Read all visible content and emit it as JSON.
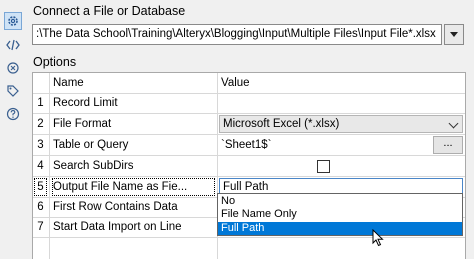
{
  "connect": {
    "label": "Connect a File or Database",
    "path_value": ":\\The Data School\\Training\\Alteryx\\Blogging\\Input\\Multiple Files\\Input File*.xlsx"
  },
  "options": {
    "label": "Options",
    "header": {
      "name": "Name",
      "value": "Value"
    },
    "rows": [
      {
        "num": "1",
        "name": "Record Limit",
        "value": ""
      },
      {
        "num": "2",
        "name": "File Format",
        "value": "Microsoft Excel (*.xlsx)"
      },
      {
        "num": "3",
        "name": "Table or Query",
        "value": "`Sheet1$`",
        "button": "..."
      },
      {
        "num": "4",
        "name": "Search SubDirs",
        "value": "",
        "checked": false
      },
      {
        "num": "5",
        "name": "Output File Name as Fie...",
        "value": "Full Path"
      },
      {
        "num": "6",
        "name": "First Row Contains Data",
        "value": ""
      },
      {
        "num": "7",
        "name": "Start Data Import on Line",
        "value": ""
      }
    ]
  },
  "dropdown": {
    "options": [
      "No",
      "File Name Only",
      "Full Path"
    ],
    "highlighted": "Full Path"
  },
  "icons": [
    "gear-icon",
    "code-icon",
    "tag-gear-icon",
    "tag-icon",
    "help-icon"
  ],
  "colors": {
    "highlight": "#0078d7",
    "focus_border": "#4a86c8"
  }
}
